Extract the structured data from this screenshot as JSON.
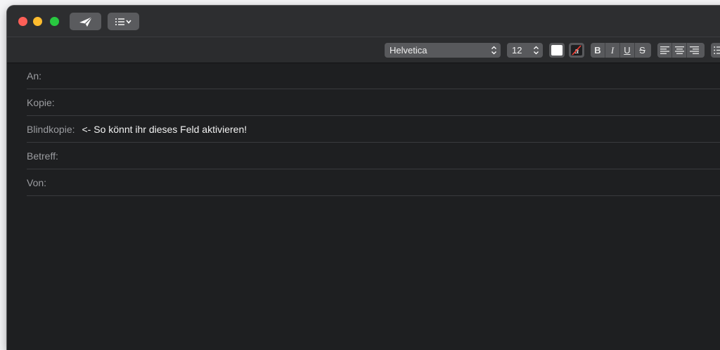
{
  "titlebar": {
    "buttons": [
      {
        "name": "send",
        "icon": "paper-plane-icon"
      },
      {
        "name": "header-fields",
        "icon": "list-chevron-icon"
      }
    ]
  },
  "format_bar": {
    "font_family": "Helvetica",
    "font_size": "12",
    "text_color": "#ffffff",
    "background_color": "#1e1f21",
    "bold_label": "B",
    "italic_label": "I",
    "underline_label": "U",
    "strikethrough_label": "S"
  },
  "fields": [
    {
      "label": "An:",
      "value": ""
    },
    {
      "label": "Kopie:",
      "value": ""
    },
    {
      "label": "Blindkopie:",
      "value": "<- So könnt ihr dieses Feld aktivieren!"
    },
    {
      "label": "Betreff:",
      "value": ""
    },
    {
      "label": "Von:",
      "value": ""
    }
  ],
  "colors": {
    "close": "#fe5f57",
    "minimize": "#febc2e",
    "zoom": "#28c840",
    "window_bg": "#1e1f21"
  }
}
